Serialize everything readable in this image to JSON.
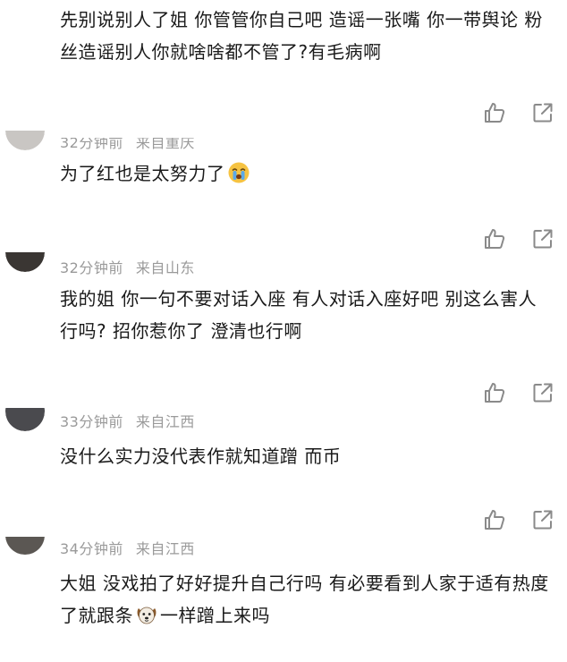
{
  "comments": [
    {
      "text": "先别说别人了姐 你管管你自己吧 造谣一张嘴 你一带舆论 粉丝造谣别人你就啥啥都不管了?有毛病啊"
    },
    {
      "time": "32分钟前",
      "location": "来自重庆",
      "text": "为了红也是太努力了",
      "emoji": "crying-face-icon"
    },
    {
      "time": "32分钟前",
      "location": "来自山东",
      "text": "我的姐 你一句不要对话入座 有人对话入座好吧 别这么害人行吗? 招你惹你了 澄清也行啊"
    },
    {
      "time": "33分钟前",
      "location": "来自江西",
      "text": "没什么实力没代表作就知道蹭 而币"
    },
    {
      "time": "34分钟前",
      "location": "来自江西",
      "text_before": "大姐 没戏拍了好好提升自己行吗 有必要看到人家于适有热度了就跟条",
      "emoji": "dog-face-icon",
      "text_after": "一样蹭上来吗"
    }
  ],
  "icons": {
    "like": "thumbs-up-icon",
    "share": "share-icon"
  },
  "colors": {
    "text": "#1a1a1a",
    "meta": "#9a9a9a",
    "icon": "#8a8a8a"
  }
}
